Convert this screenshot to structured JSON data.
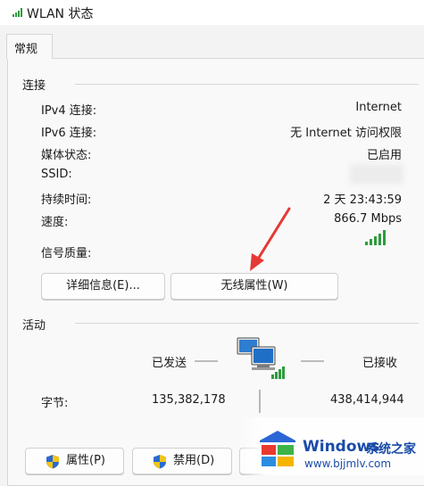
{
  "window": {
    "title": "WLAN 状态"
  },
  "tabs": [
    {
      "label": "常规"
    }
  ],
  "connection": {
    "section_label": "连接",
    "rows": [
      {
        "label": "IPv4 连接:",
        "value": "Internet"
      },
      {
        "label": "IPv6 连接:",
        "value": "无 Internet 访问权限"
      },
      {
        "label": "媒体状态:",
        "value": "已启用"
      },
      {
        "label": "SSID:",
        "value": ""
      },
      {
        "label": "持续时间:",
        "value": "2 天 23:43:59"
      },
      {
        "label": "速度:",
        "value": "866.7 Mbps"
      }
    ],
    "signal_label": "信号质量:",
    "signal_bars": 5,
    "details_button": "详细信息(E)...",
    "wireless_props_button": "无线属性(W)"
  },
  "activity": {
    "section_label": "活动",
    "sent_label": "已发送",
    "received_label": "已接收",
    "bytes_label": "字节:",
    "bytes_sent": "135,382,178",
    "bytes_received": "438,414,944"
  },
  "footer": {
    "properties_button": "属性(P)",
    "disable_button": "禁用(D)"
  },
  "watermark": {
    "brand": "Windows",
    "suffix": "系统之家",
    "url": "www.bjjmlv.com"
  },
  "colors": {
    "signal_green": "#2e9b3c",
    "annotation_arrow": "#e53935",
    "watermark_blue": "#1a4ba8"
  }
}
